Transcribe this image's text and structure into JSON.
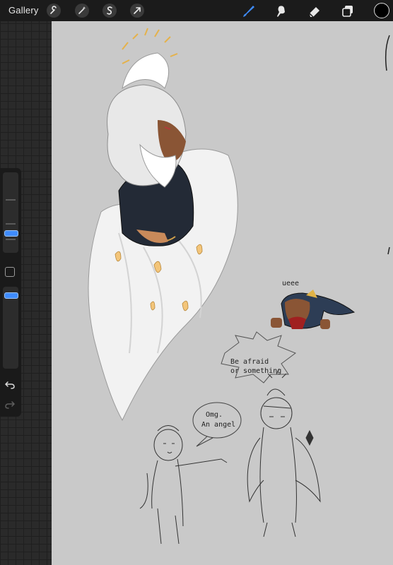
{
  "topbar": {
    "gallery_label": "Gallery",
    "left_tools": [
      "wrench-icon",
      "magic-wand-icon",
      "selection-s-icon",
      "transform-arrow-icon"
    ],
    "right_tools": [
      "brush-icon",
      "smudge-icon",
      "eraser-icon",
      "layers-icon"
    ],
    "active_tool": "brush-icon",
    "active_tool_color": "#3f8cff",
    "current_color": "#000000"
  },
  "sidebar": {
    "icons": [
      "modify-square-icon",
      "undo-icon",
      "redo-icon"
    ]
  },
  "canvas": {
    "background": "#c9c9c9",
    "texts": {
      "whine": "ueee",
      "shout_line1": "Be afraid",
      "shout_line2": "or something",
      "omg_line1": "Omg.",
      "omg_line2": "An angel"
    }
  }
}
